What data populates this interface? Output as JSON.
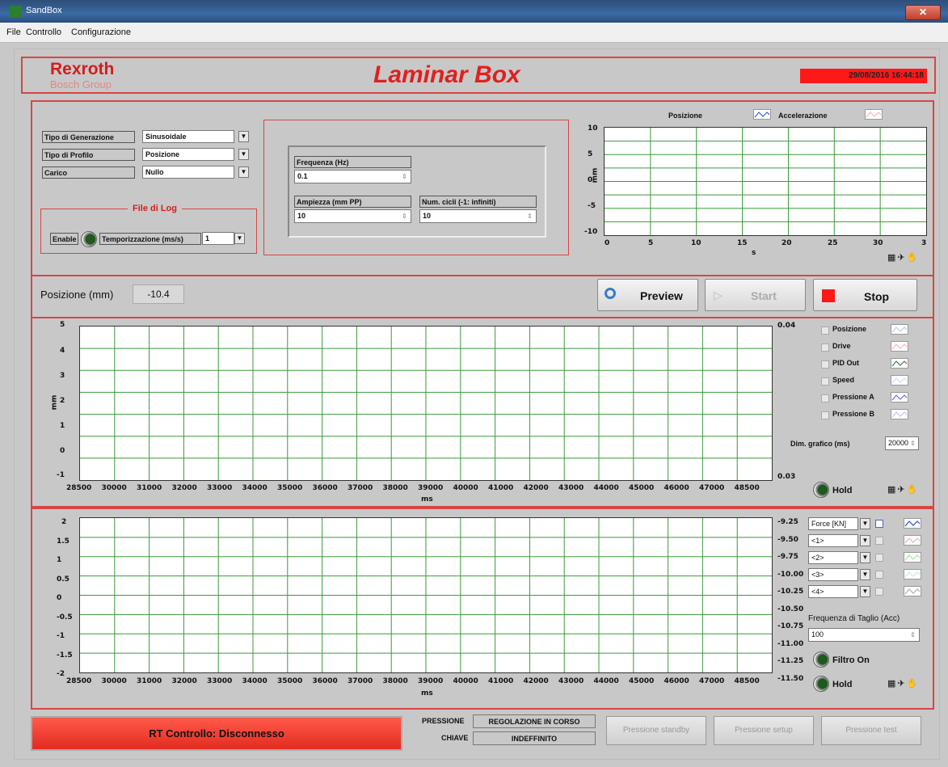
{
  "window": {
    "title": "SandBox",
    "close_glyph": "✕"
  },
  "menu": [
    "File",
    "Controllo",
    "Configurazione"
  ],
  "header": {
    "brand": "Rexroth",
    "brand_sub": "Bosch Group",
    "app_title": "Laminar Box",
    "datetime": "29/08/2016 16:44:18"
  },
  "config": {
    "labels": [
      "Tipo di Generazione",
      "Tipo di Profilo",
      "Carico"
    ],
    "values": [
      "Sinusoidale",
      "Posizione",
      "Nullo"
    ],
    "log_title": "File di Log",
    "enable_label": "Enable",
    "timing_label": "Temporizzazione (ms/s)",
    "timing_value": "1"
  },
  "params": {
    "freq_label": "Frequenza (Hz)",
    "freq_value": "0.1",
    "amp_label": "Ampiezza (mm PP)",
    "amp_value": "10",
    "cycles_label": "Num. cicli (-1: infiniti)",
    "cycles_value": "10"
  },
  "preview_chart": {
    "legend": [
      "Posizione",
      "Accelerazione"
    ],
    "ylabel": "mm",
    "xlabel": "s",
    "y_ticks": [
      "10",
      "5",
      "0",
      "-5",
      "-10"
    ],
    "x_ticks": [
      "0",
      "5",
      "10",
      "15",
      "20",
      "25",
      "30",
      "3"
    ]
  },
  "status": {
    "pos_label": "Posizione (mm)",
    "pos_value": "-10.4"
  },
  "buttons": {
    "preview": "Preview",
    "start": "Start",
    "stop": "Stop"
  },
  "main_chart": {
    "y_ticks": [
      "5",
      "4",
      "3",
      "2",
      "1",
      "0",
      "-1"
    ],
    "ylabel": "mm",
    "xlabel": "ms",
    "x_ticks": [
      "28500",
      "30000",
      "31000",
      "32000",
      "33000",
      "34000",
      "35000",
      "36000",
      "37000",
      "38000",
      "39000",
      "40000",
      "41000",
      "42000",
      "43000",
      "44000",
      "45000",
      "46000",
      "47000",
      "48500"
    ],
    "right_top": "0.04",
    "right_bottom": "0.03",
    "legend": [
      "Posizione",
      "Drive",
      "PID Out",
      "Speed",
      "Pressione A",
      "Pressione B"
    ],
    "dim_label": "Dim. grafico (ms)",
    "dim_value": "20000",
    "hold_label": "Hold"
  },
  "force_chart": {
    "y_ticks": [
      "2",
      "1.5",
      "1",
      "0.5",
      "0",
      "-0.5",
      "-1",
      "-1.5",
      "-2"
    ],
    "xlabel": "ms",
    "x_ticks": [
      "28500",
      "30000",
      "31000",
      "32000",
      "33000",
      "34000",
      "35000",
      "36000",
      "37000",
      "38000",
      "39000",
      "40000",
      "41000",
      "42000",
      "43000",
      "44000",
      "45000",
      "46000",
      "47000",
      "48500"
    ],
    "right_ticks": [
      "-9.25",
      "-9.50",
      "-9.75",
      "-10.00",
      "-10.25",
      "-10.50",
      "-10.75",
      "-11.00",
      "-11.25",
      "-11.50"
    ],
    "channels": [
      "Force [KN]",
      "<1>",
      "<2>",
      "<3>",
      "<4>"
    ],
    "cutoff_label": "Frequenza di Taglio (Acc)",
    "cutoff_value": "100",
    "filter_label": "Filtro On",
    "hold_label": "Hold"
  },
  "footer": {
    "rt_status": "RT Controllo: Disconnesso",
    "pressure_label": "PRESSIONE",
    "pressure_value": "REGOLAZIONE IN CORSO",
    "key_label": "CHIAVE",
    "key_value": "INDEFFINITO",
    "btn_standby": "Pressione standby",
    "btn_setup": "Pressione setup",
    "btn_test": "Pressione test"
  },
  "colors": {
    "accent_red": "#e02020",
    "grid_green": "#2e8b2e",
    "panel_border": "#d84545"
  }
}
